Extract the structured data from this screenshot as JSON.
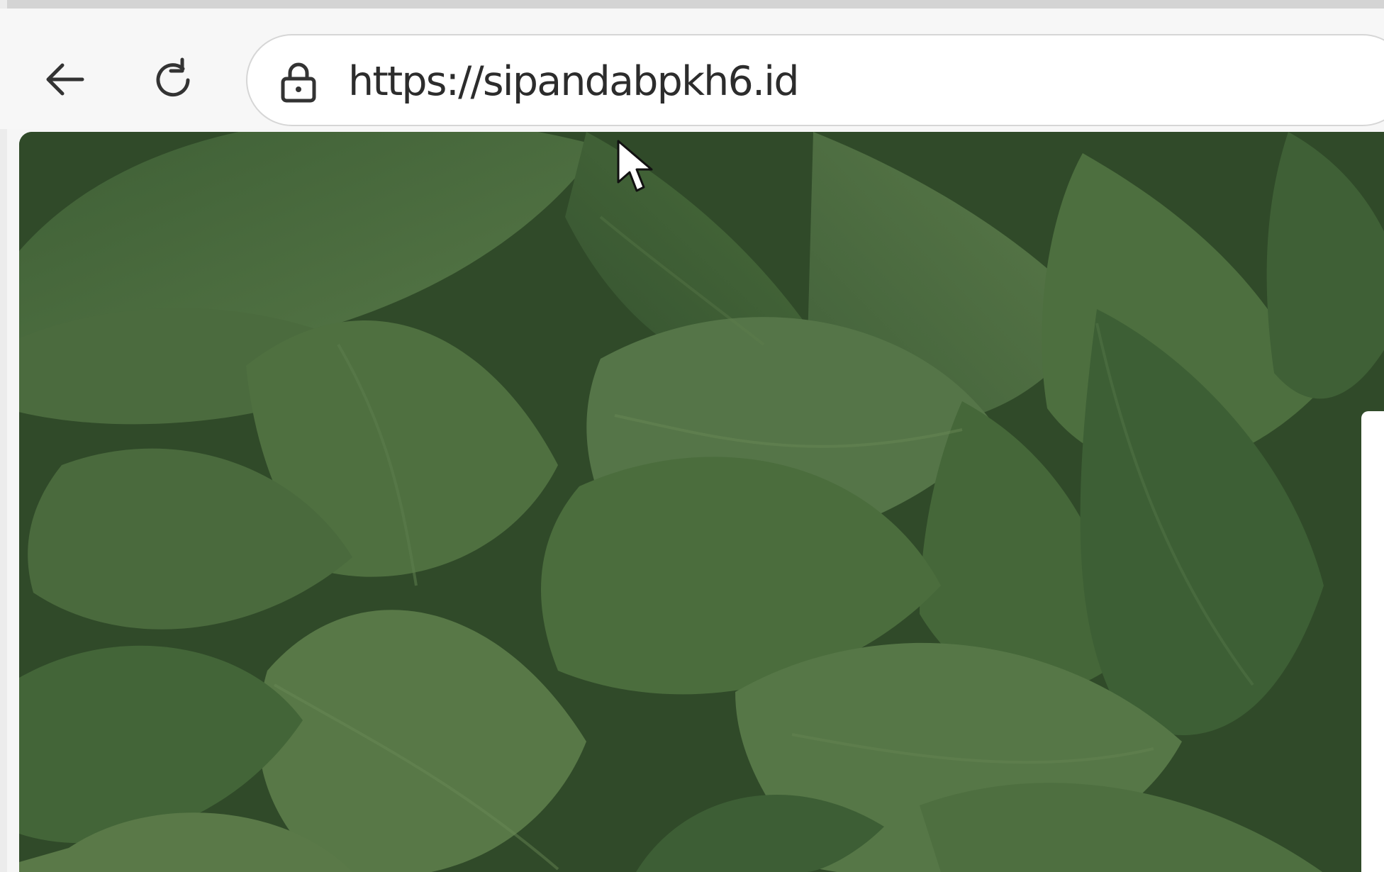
{
  "browser": {
    "url": "https://sipandabpkh6.id",
    "controls": {
      "back_icon": "arrow-left-icon",
      "reload_icon": "refresh-icon",
      "lock_icon": "lock-icon"
    }
  },
  "content": {
    "background": "green leaf pattern",
    "accent_colors": [
      "#2f4727",
      "#3e6238",
      "#4d6f3e",
      "#587546"
    ]
  }
}
